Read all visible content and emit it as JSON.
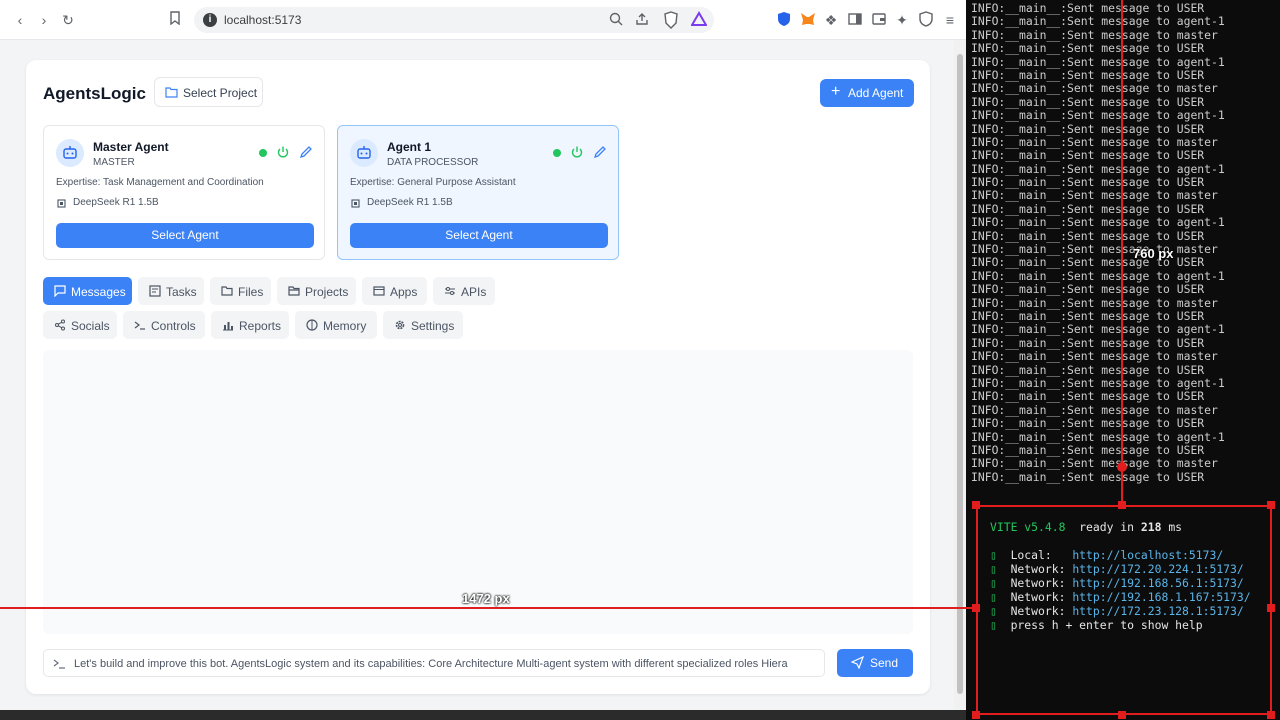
{
  "browser": {
    "url": "localhost:5173"
  },
  "app": {
    "title": "AgentsLogic",
    "select_project_label": "Select Project",
    "add_agent_label": "Add Agent",
    "agents": [
      {
        "name": "Master Agent",
        "role": "MASTER",
        "expertise": "Expertise: Task Management and Coordination",
        "model": "DeepSeek R1 1.5B",
        "select_label": "Select Agent",
        "status": "online",
        "selected": false
      },
      {
        "name": "Agent 1",
        "role": "DATA PROCESSOR",
        "expertise": "Expertise: General Purpose Assistant",
        "model": "DeepSeek R1 1.5B",
        "select_label": "Select Agent",
        "status": "online",
        "selected": true
      }
    ],
    "tabs_row1": [
      {
        "label": "Messages",
        "icon": "message-icon",
        "active": true
      },
      {
        "label": "Tasks",
        "icon": "tasks-icon",
        "active": false
      },
      {
        "label": "Files",
        "icon": "folder-icon",
        "active": false
      },
      {
        "label": "Projects",
        "icon": "folder-open-icon",
        "active": false
      },
      {
        "label": "Apps",
        "icon": "window-icon",
        "active": false
      },
      {
        "label": "APIs",
        "icon": "sliders-icon",
        "active": false
      }
    ],
    "tabs_row2": [
      {
        "label": "Socials",
        "icon": "share-icon",
        "active": false
      },
      {
        "label": "Controls",
        "icon": "terminal-icon",
        "active": false
      },
      {
        "label": "Reports",
        "icon": "bar-chart-icon",
        "active": false
      },
      {
        "label": "Memory",
        "icon": "brain-icon",
        "active": false
      },
      {
        "label": "Settings",
        "icon": "gear-icon",
        "active": false
      }
    ],
    "chat_input_value": "Let's build and improve this bot. AgentsLogic system and its capabilities:  Core Architecture Multi-agent system with different specialized roles Hiera",
    "send_label": "Send"
  },
  "terminal": {
    "log_lines": [
      "INFO:__main__:Sent message to USER",
      "INFO:__main__:Sent message to agent-1",
      "INFO:__main__:Sent message to master",
      "INFO:__main__:Sent message to USER",
      "INFO:__main__:Sent message to agent-1",
      "INFO:__main__:Sent message to USER",
      "INFO:__main__:Sent message to master",
      "INFO:__main__:Sent message to USER",
      "INFO:__main__:Sent message to agent-1",
      "INFO:__main__:Sent message to USER",
      "INFO:__main__:Sent message to master",
      "INFO:__main__:Sent message to USER",
      "INFO:__main__:Sent message to agent-1",
      "INFO:__main__:Sent message to USER",
      "INFO:__main__:Sent message to master",
      "INFO:__main__:Sent message to USER",
      "INFO:__main__:Sent message to agent-1",
      "INFO:__main__:Sent message to USER",
      "INFO:__main__:Sent message to master",
      "INFO:__main__:Sent message to USER",
      "INFO:__main__:Sent message to agent-1",
      "INFO:__main__:Sent message to USER",
      "INFO:__main__:Sent message to master",
      "INFO:__main__:Sent message to USER",
      "INFO:__main__:Sent message to agent-1",
      "INFO:__main__:Sent message to USER",
      "INFO:__main__:Sent message to master",
      "INFO:__main__:Sent message to USER",
      "INFO:__main__:Sent message to agent-1",
      "INFO:__main__:Sent message to USER",
      "INFO:__main__:Sent message to master",
      "INFO:__main__:Sent message to USER",
      "INFO:__main__:Sent message to agent-1",
      "INFO:__main__:Sent message to USER",
      "INFO:__main__:Sent message to master",
      "INFO:__main__:Sent message to USER"
    ],
    "vite_version": "VITE v5.4.8",
    "ready_text": "ready in ",
    "ready_ms": "218",
    "ready_unit": " ms",
    "local_label": "Local:",
    "local_url": "http://localhost:5173/",
    "network_label": "Network:",
    "network_urls": [
      "http://172.20.224.1:5173/",
      "http://192.168.56.1:5173/",
      "http://192.168.1.167:5173/",
      "http://172.23.128.1:5173/"
    ],
    "help_text": "press h + enter to show help"
  },
  "overlay": {
    "horizontal_label": "1472 px",
    "vertical_label": "760 px",
    "color": "#e11d1d"
  }
}
